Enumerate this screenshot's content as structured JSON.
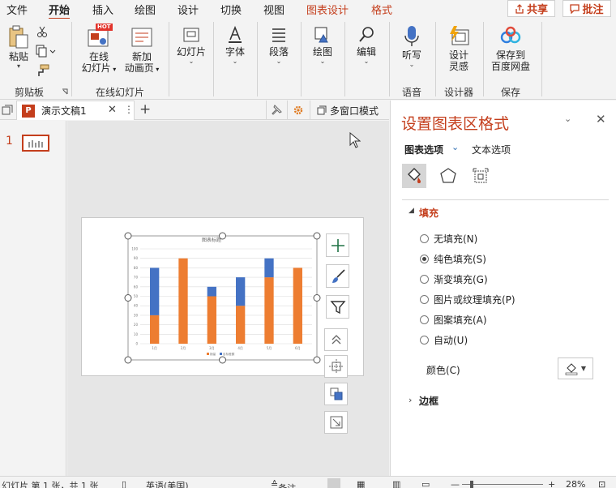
{
  "tabs": {
    "items": [
      "文件",
      "开始",
      "插入",
      "绘图",
      "设计",
      "切换",
      "视图"
    ],
    "contextual": [
      "图表设计",
      "格式"
    ],
    "share": "共享",
    "comment": "批注"
  },
  "ribbon": {
    "paste": "粘贴",
    "clipboard_group": "剪贴板",
    "online_slide_1": "在线",
    "online_slide_2": "幻灯片",
    "new_anim_1": "新加",
    "new_anim_2": "动画页",
    "online_group": "在线幻灯片",
    "hot_badge": "HOT",
    "slides": "幻灯片",
    "font": "字体",
    "paragraph": "段落",
    "drawing": "绘图",
    "editing": "编辑",
    "dictate": "听写",
    "voice_group": "语音",
    "designer_1": "设计",
    "designer_2": "灵感",
    "designer_group": "设计器",
    "save_cloud_1": "保存到",
    "save_cloud_2": "百度网盘",
    "save_group": "保存"
  },
  "document": {
    "tab_name": "演示文稿1",
    "multiwindow": "多窗口模式",
    "slide_number": "1"
  },
  "chart_data": {
    "type": "bar",
    "stacked": true,
    "title": "图表标题",
    "categories": [
      "1月",
      "2月",
      "3月",
      "4月",
      "5月",
      "6月"
    ],
    "series": [
      {
        "name": "销量",
        "values": [
          30,
          90,
          50,
          40,
          70,
          80
        ],
        "color": "#ed7d31"
      },
      {
        "name": "目标差额",
        "values": [
          50,
          0,
          10,
          30,
          20,
          0
        ],
        "color": "#4472c4"
      }
    ],
    "ylim": [
      0,
      100
    ],
    "yticks": [
      0,
      10,
      20,
      30,
      40,
      50,
      60,
      70,
      80,
      90,
      100
    ],
    "grid": true,
    "legend": "bottom"
  },
  "pane": {
    "title": "设置图表区格式",
    "tab_chart_options": "图表选项",
    "tab_text_options": "文本选项",
    "fill_header": "填充",
    "fill_options": [
      "无填充(N)",
      "纯色填充(S)",
      "渐变填充(G)",
      "图片或纹理填充(P)",
      "图案填充(A)",
      "自动(U)"
    ],
    "selected_fill": 1,
    "color_label": "颜色(C)",
    "border_header": "边框"
  },
  "status": {
    "slide_info": "幻灯片 第 1 张，共 1 张",
    "language": "英语(美国)",
    "notes": "备注",
    "zoom": "28%"
  },
  "colors": {
    "accent": "#c43e1c",
    "orange": "#ed7d31",
    "blue": "#4472c4"
  }
}
